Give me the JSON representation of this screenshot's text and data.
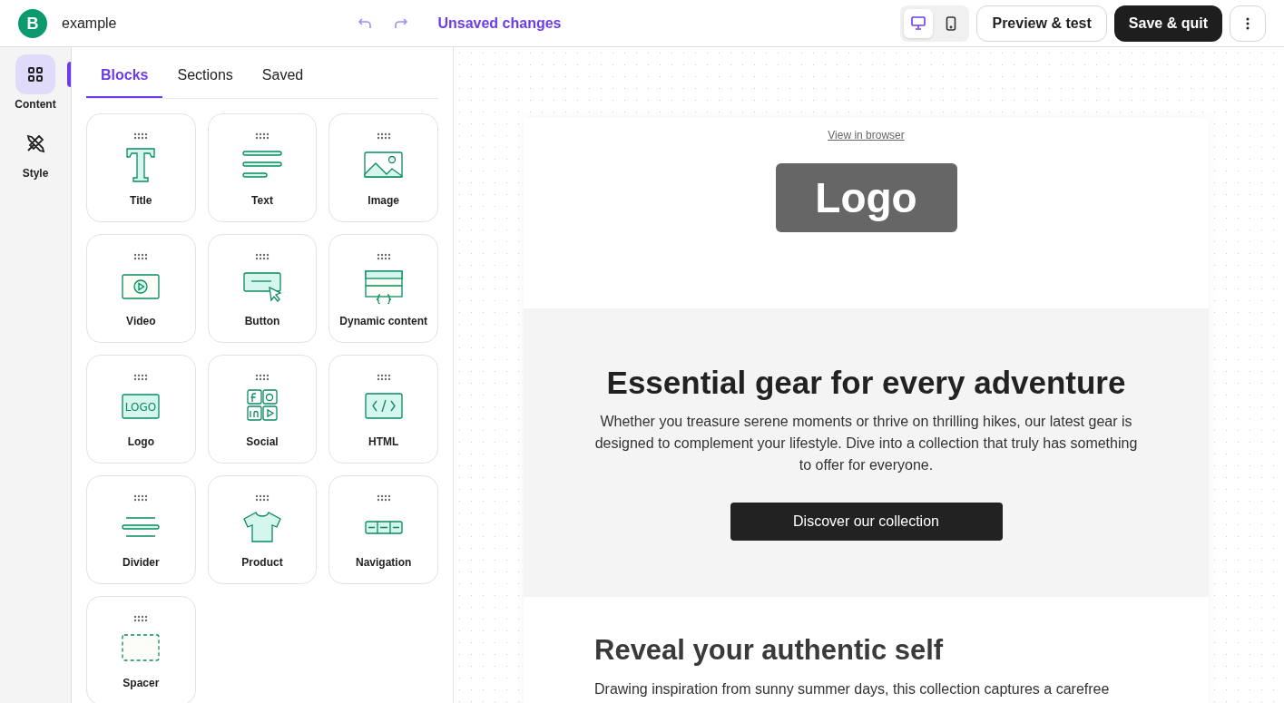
{
  "header": {
    "logo_letter": "B",
    "document_name": "example",
    "status": "Unsaved changes",
    "devices": [
      {
        "kind": "desktop",
        "selected": true
      },
      {
        "kind": "mobile",
        "selected": false
      }
    ],
    "buttons": [
      {
        "kind": "outline",
        "label": "Preview & test"
      },
      {
        "kind": "solid",
        "label": "Save & quit"
      }
    ]
  },
  "rail": [
    {
      "kind": "content",
      "label": "Content",
      "selected": true
    },
    {
      "kind": "style",
      "label": "Style",
      "selected": false
    }
  ],
  "tabs": [
    {
      "label": "Blocks",
      "selected": true
    },
    {
      "label": "Sections",
      "selected": false
    },
    {
      "label": "Saved",
      "selected": false
    }
  ],
  "blocks": [
    {
      "kind": "title",
      "label": "Title"
    },
    {
      "kind": "text",
      "label": "Text"
    },
    {
      "kind": "image",
      "label": "Image"
    },
    {
      "kind": "video",
      "label": "Video"
    },
    {
      "kind": "button",
      "label": "Button"
    },
    {
      "kind": "dynamic",
      "label": "Dynamic content"
    },
    {
      "kind": "logo",
      "label": "Logo",
      "icon_text": "LOGO"
    },
    {
      "kind": "social",
      "label": "Social"
    },
    {
      "kind": "html",
      "label": "HTML"
    },
    {
      "kind": "divider",
      "label": "Divider"
    },
    {
      "kind": "product",
      "label": "Product"
    },
    {
      "kind": "navigation",
      "label": "Navigation"
    },
    {
      "kind": "spacer",
      "label": "Spacer"
    }
  ],
  "email": {
    "view_link": "View in browser",
    "logo": "Logo",
    "hero": {
      "heading": "Essential gear for every adventure",
      "body": "Whether you treasure serene moments or thrive on thrilling hikes, our latest gear is designed to complement your lifestyle. Dive into a collection that truly has something to offer for everyone.",
      "button": "Discover our collection"
    },
    "section": {
      "heading": "Reveal your authentic self",
      "body": "Drawing inspiration from sunny summer days, this collection captures a carefree"
    }
  }
}
